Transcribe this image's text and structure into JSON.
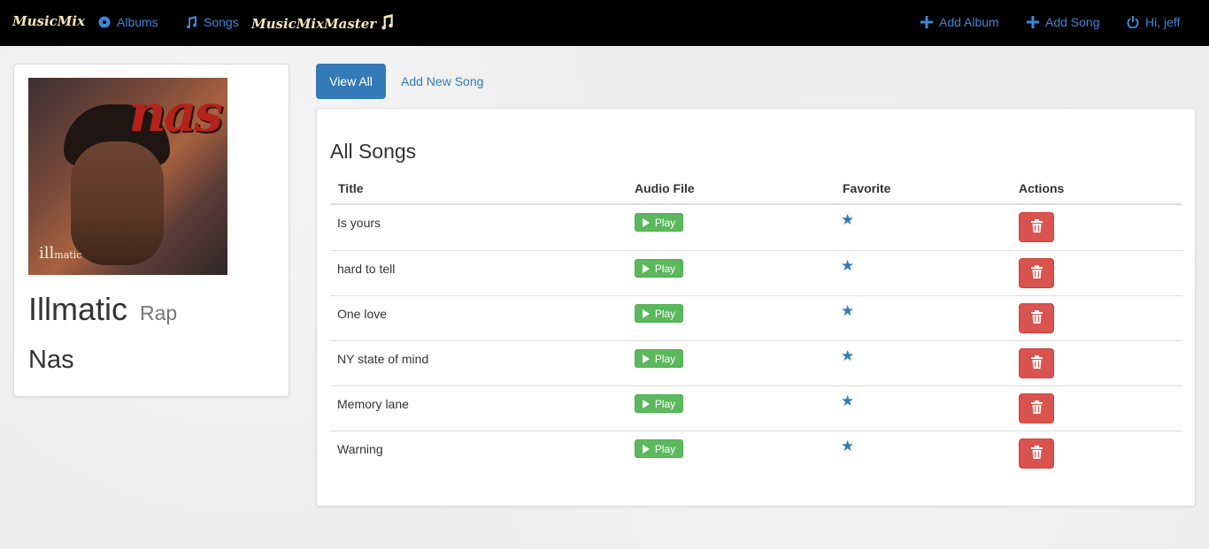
{
  "navbar": {
    "brand": "MusicMix",
    "albums": "Albums",
    "songs": "Songs",
    "master_brand": "MusicMixMaster",
    "add_album": "Add Album",
    "add_song": "Add Song",
    "user": "Hi, jeff"
  },
  "album": {
    "title": "Illmatic",
    "genre": "Rap",
    "artist": "Nas",
    "cover_text_big": "nas",
    "cover_text_small_a": "ill",
    "cover_text_small_b": "matic"
  },
  "tabs": {
    "view_all": "View All",
    "add_new_song": "Add New Song"
  },
  "songs_panel": {
    "heading": "All Songs",
    "columns": [
      "Title",
      "Audio File",
      "Favorite",
      "Actions"
    ],
    "play_label": "Play",
    "rows": [
      {
        "title": "Is yours",
        "favorite": true
      },
      {
        "title": "hard to tell",
        "favorite": true
      },
      {
        "title": "One love",
        "favorite": true
      },
      {
        "title": "NY state of mind",
        "favorite": true
      },
      {
        "title": "Memory lane",
        "favorite": true
      },
      {
        "title": "Warning",
        "favorite": true
      }
    ]
  },
  "icons": {
    "albums": "disc-icon",
    "songs": "music-note-icon",
    "add": "plus-icon",
    "logout": "power-icon",
    "play": "play-icon",
    "favorite": "star-icon",
    "delete": "trash-icon"
  },
  "colors": {
    "primary": "#337ab7",
    "success": "#5cb85c",
    "danger": "#d9534f",
    "navbar": "#000000",
    "brand": "#f4e7b8"
  }
}
